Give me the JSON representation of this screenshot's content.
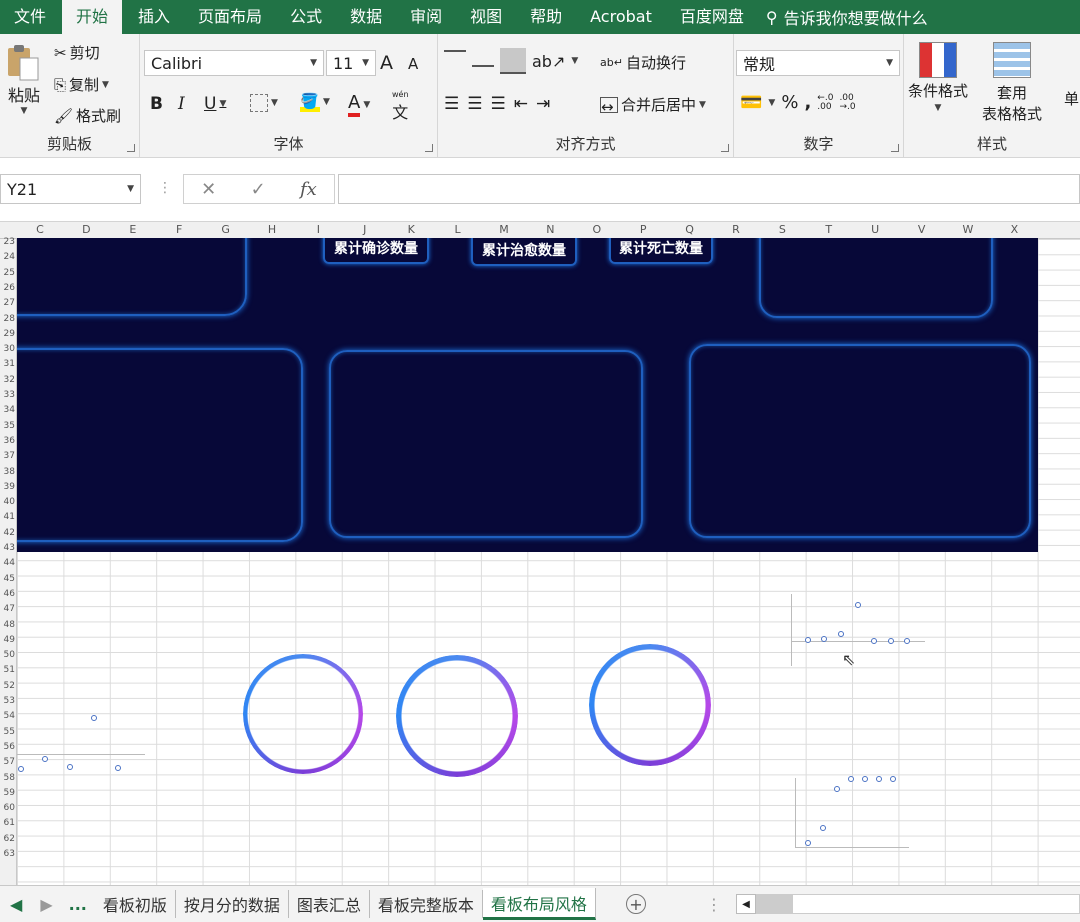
{
  "ribbon_tabs": [
    "文件",
    "开始",
    "插入",
    "页面布局",
    "公式",
    "数据",
    "审阅",
    "视图",
    "帮助",
    "Acrobat",
    "百度网盘"
  ],
  "active_tab": "开始",
  "tell_me": "告诉我你想要做什么",
  "clipboard": {
    "paste": "粘贴",
    "cut": "剪切",
    "copy": "复制",
    "format_painter": "格式刷",
    "label": "剪贴板"
  },
  "font": {
    "name": "Calibri",
    "size": "11",
    "grow": "A",
    "shrink": "A",
    "bold": "B",
    "italic": "I",
    "underline": "U",
    "label": "字体",
    "phonetic": "文",
    "phonetic_top": "wén"
  },
  "alignment": {
    "wrap": "自动换行",
    "merge": "合并后居中",
    "label": "对齐方式"
  },
  "number": {
    "format": "常规",
    "percent": "%",
    "comma": ",",
    "label": "数字"
  },
  "styles": {
    "conditional": "条件格式",
    "table_fmt_1": "套用",
    "table_fmt_2": "表格格式",
    "cell": "单",
    "label": "样式"
  },
  "formula_bar": {
    "name_box": "Y21",
    "fx": "fx",
    "cancel": "✕",
    "enter": "✓",
    "content": ""
  },
  "columns": [
    "C",
    "D",
    "E",
    "F",
    "G",
    "H",
    "I",
    "J",
    "K",
    "L",
    "M",
    "N",
    "O",
    "P",
    "Q",
    "R",
    "S",
    "T",
    "U",
    "V",
    "W",
    "X"
  ],
  "rows": [
    "23",
    "24",
    "25",
    "26",
    "27",
    "28",
    "29",
    "30",
    "31",
    "32",
    "33",
    "34",
    "35",
    "36",
    "37",
    "38",
    "39",
    "40",
    "41",
    "42",
    "43",
    "44",
    "45",
    "46",
    "47",
    "48",
    "49",
    "50",
    "51",
    "52",
    "53",
    "54",
    "55",
    "56",
    "57",
    "58",
    "59",
    "60",
    "61",
    "62",
    "63"
  ],
  "kpis": [
    "累计确诊数量",
    "累计治愈数量",
    "累计死亡数量"
  ],
  "sheets": [
    "看板初版",
    "按月分的数据",
    "图表汇总",
    "看板完整版本",
    "看板布局风格"
  ],
  "active_sheet": "看板布局风格",
  "more": "..."
}
